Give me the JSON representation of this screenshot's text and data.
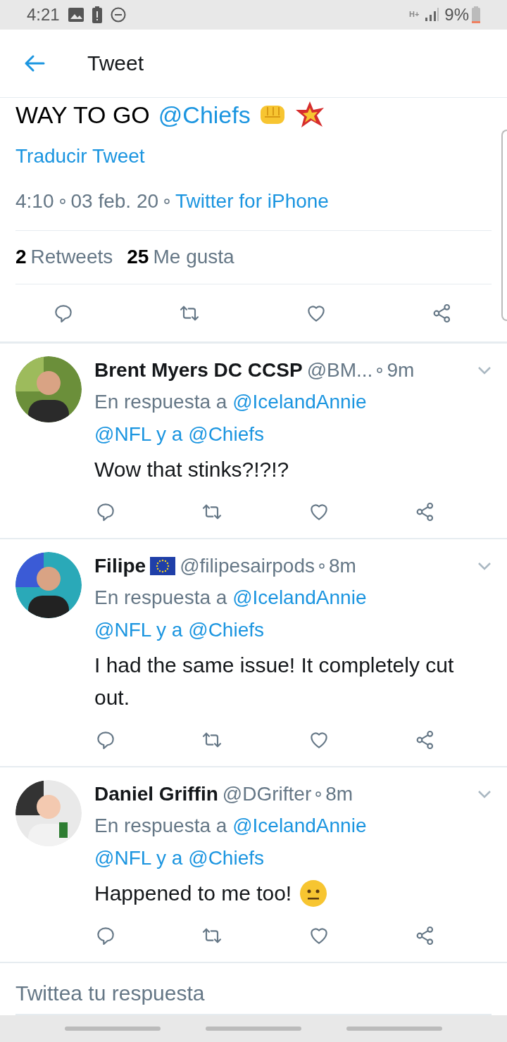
{
  "status_bar": {
    "time": "4:21",
    "network": "H+",
    "battery": "9%"
  },
  "header": {
    "title": "Tweet"
  },
  "tweet": {
    "text": "WAY TO GO",
    "mention": "@Chiefs",
    "translate": "Traducir Tweet",
    "time": "4:10",
    "date": "03 feb. 20",
    "source": "Twitter for iPhone",
    "stats": [
      {
        "count": "2",
        "label": "Retweets"
      },
      {
        "count": "25",
        "label": "Me gusta"
      }
    ]
  },
  "replies": [
    {
      "name": "Brent Myers DC CCSP",
      "flag": false,
      "handle": "@BM...",
      "time": "9m",
      "prefix": "En respuesta a",
      "mention_1": "@IcelandAnnie",
      "mention_2": "@NFL",
      "joiner": "y a",
      "mention_3": "@Chiefs",
      "text": "Wow that stinks?!?!?",
      "emoji": false
    },
    {
      "name": "Filipe",
      "flag": true,
      "handle": "@filipesairpods",
      "time": "8m",
      "prefix": "En respuesta a",
      "mention_1": "@IcelandAnnie",
      "mention_2": "@NFL",
      "joiner": "y a",
      "mention_3": "@Chiefs",
      "text": "I had the same issue! It completely cut out.",
      "emoji": false
    },
    {
      "name": "Daniel Griffin",
      "flag": false,
      "handle": "@DGrifter",
      "time": "8m",
      "prefix": "En respuesta a",
      "mention_1": "@IcelandAnnie",
      "mention_2": "@NFL",
      "joiner": "y a",
      "mention_3": "@Chiefs",
      "text": "Happened to me too!",
      "emoji": true
    }
  ],
  "reply_field": {
    "placeholder": "Twittea tu respuesta"
  }
}
